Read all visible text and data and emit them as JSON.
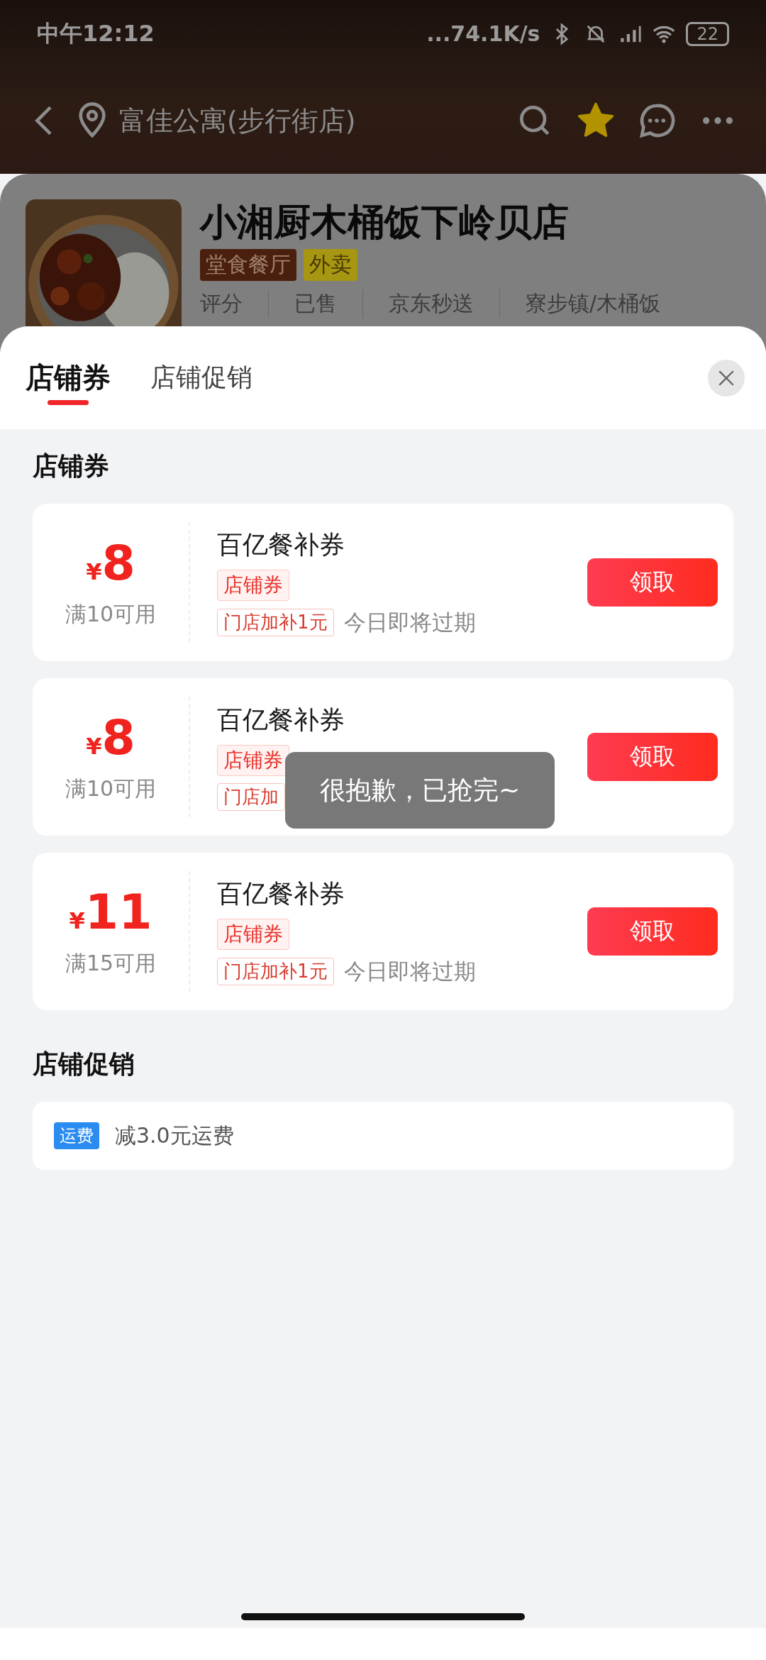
{
  "status_bar": {
    "time": "中午12:12",
    "network_speed": "...74.1K/s",
    "battery": "22"
  },
  "header": {
    "location": "富佳公寓(步行街店)",
    "favorited": true
  },
  "store": {
    "name": "小湘厨木桶饭下岭贝店",
    "tags": [
      {
        "label": "堂食餐厅",
        "kind": "dine_in"
      },
      {
        "label": "外卖",
        "kind": "delivery"
      }
    ],
    "stats": [
      "评分",
      "已售",
      "京东秒送",
      "寮步镇/木桶饭"
    ]
  },
  "sheet": {
    "tabs": [
      {
        "label": "店铺券",
        "selected": true
      },
      {
        "label": "店铺促销",
        "selected": false
      }
    ]
  },
  "coupon_section": {
    "title": "店铺券",
    "coupons": [
      {
        "currency": "¥",
        "amount": "8",
        "condition": "满10可用",
        "name": "百亿餐补券",
        "type_tag": "店铺券",
        "bonus_tag": "门店加补1元",
        "expiry": "今日即将过期",
        "button": "领取"
      },
      {
        "currency": "¥",
        "amount": "8",
        "condition": "满10可用",
        "name": "百亿餐补券",
        "type_tag": "店铺券",
        "bonus_tag": "门店加",
        "button": "领取"
      },
      {
        "currency": "¥",
        "amount": "11",
        "condition": "满15可用",
        "name": "百亿餐补券",
        "type_tag": "店铺券",
        "bonus_tag": "门店加补1元",
        "expiry": "今日即将过期",
        "button": "领取"
      }
    ]
  },
  "promo_section": {
    "title": "店铺促销",
    "promotions": [
      {
        "tag": "运费",
        "text": "减3.0元运费"
      }
    ]
  },
  "toast": {
    "message": "很抱歉，已抢完~"
  }
}
